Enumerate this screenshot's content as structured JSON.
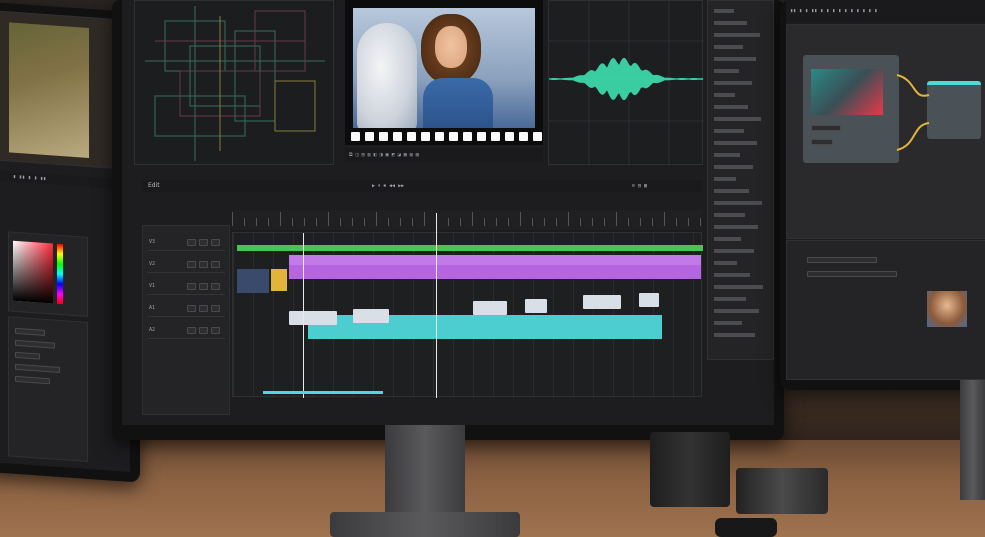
{
  "colors": {
    "accent_magenta": "#b565e0",
    "accent_cyan": "#4fd7d9",
    "accent_green": "#46c45a",
    "accent_yellow": "#e2b43a",
    "waveform": "#3fe0b0",
    "playhead": "#e8e8e8"
  },
  "editor": {
    "toolbar_label": "Edit",
    "timeline_tracks": [
      {
        "name": "V3",
        "type": "video"
      },
      {
        "name": "V2",
        "type": "video"
      },
      {
        "name": "V1",
        "type": "video"
      },
      {
        "name": "A1",
        "type": "audio"
      },
      {
        "name": "A2",
        "type": "audio"
      }
    ],
    "clips": [
      {
        "track": "V2",
        "color": "magenta"
      },
      {
        "track": "A1",
        "color": "cyan"
      },
      {
        "track": "V1",
        "color": "yellow"
      },
      {
        "track": "V3",
        "color": "green"
      }
    ],
    "icons": [
      "play-icon",
      "pause-icon",
      "stop-icon",
      "rewind-icon",
      "forward-icon",
      "scissors-icon",
      "gear-icon"
    ]
  },
  "preview": {
    "subject": "woman with curly hair next to white horse",
    "frame": "film-strip"
  },
  "node_editor": {
    "nodes": [
      {
        "name": "color-node"
      },
      {
        "name": "output-node"
      }
    ]
  }
}
